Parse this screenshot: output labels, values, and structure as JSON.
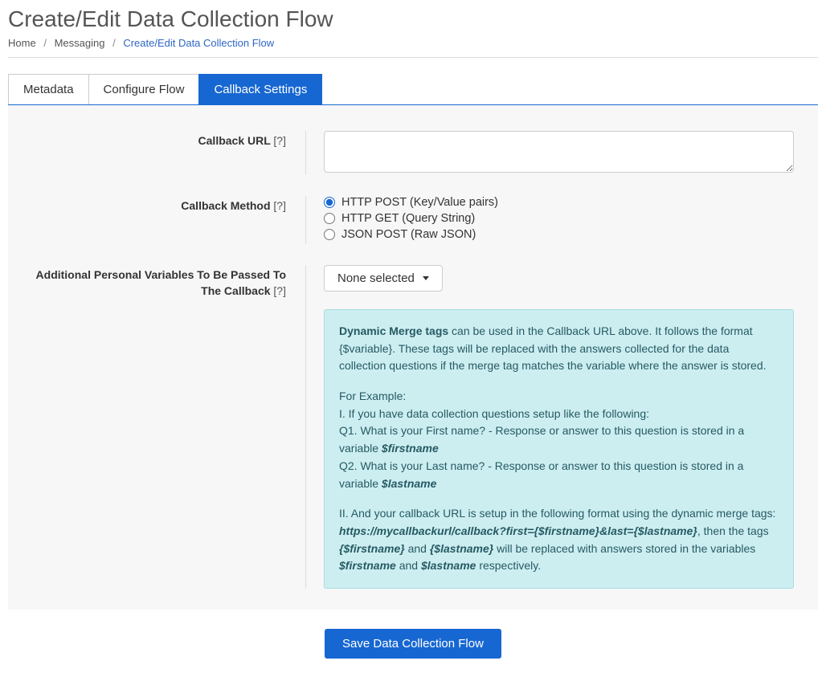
{
  "page": {
    "title": "Create/Edit Data Collection Flow"
  },
  "breadcrumb": {
    "home": "Home",
    "messaging": "Messaging",
    "current": "Create/Edit Data Collection Flow"
  },
  "tabs": {
    "metadata": "Metadata",
    "configure": "Configure Flow",
    "callback": "Callback Settings"
  },
  "labels": {
    "callback_url": "Callback URL",
    "callback_method": "Callback Method",
    "additional_vars": "Additional Personal Variables To Be Passed To The Callback",
    "help": "[?]"
  },
  "methods": {
    "post": "HTTP POST (Key/Value pairs)",
    "get": "HTTP GET (Query String)",
    "json": "JSON POST (Raw JSON)"
  },
  "dropdown": {
    "selected": "None selected"
  },
  "info": {
    "lead_strong": "Dynamic Merge tags",
    "lead_rest": " can be used in the Callback URL above. It follows the format {$variable}. These tags will be replaced with the answers collected for the data collection questions if the merge tag matches the variable where the answer is stored.",
    "example_header": "For Example:",
    "line1": "I. If you have data collection questions setup like the following:",
    "q1_prefix": "Q1. What is your First name? - Response or answer to this question is stored in a variable ",
    "q1_var": "$firstname",
    "q2_prefix": "Q2. What is your Last name? - Response or answer to this question is stored in a variable ",
    "q2_var": "$lastname",
    "part2_prefix": "II. And your callback URL is setup in the following format using the dynamic merge tags:",
    "url_example": "https://mycallbackurl/callback?first={$firstname}&last={$lastname}",
    "part2_mid1": ", then the tags ",
    "tag1": "{$firstname}",
    "part2_mid2": " and ",
    "tag2": "{$lastname}",
    "part2_mid3": " will be replaced with answers stored in the variables ",
    "var1": "$firstname",
    "part2_mid4": " and ",
    "var2": "$lastname",
    "part2_end": " respectively."
  },
  "buttons": {
    "save": "Save Data Collection Flow"
  }
}
